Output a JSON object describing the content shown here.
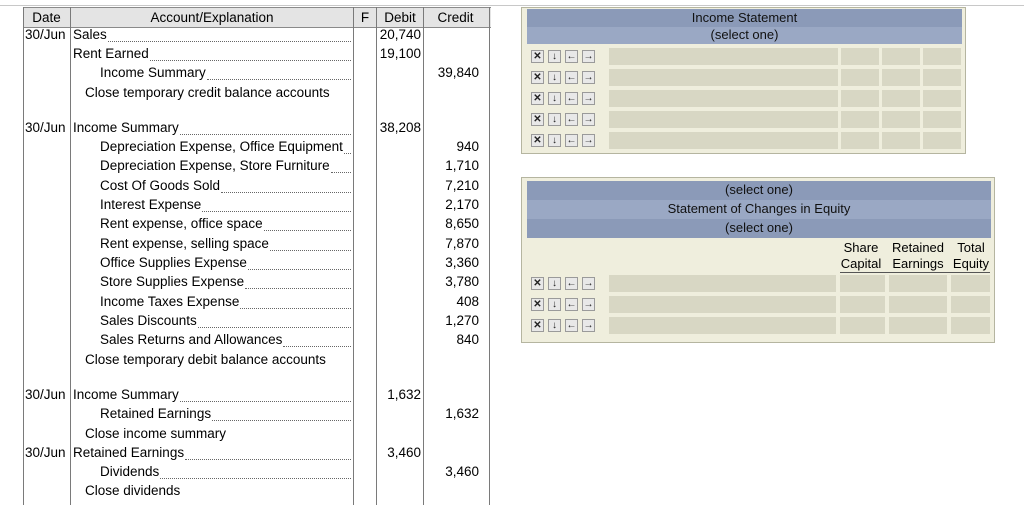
{
  "journal": {
    "headers": {
      "date": "Date",
      "account": "Account/Explanation",
      "f": "F",
      "debit": "Debit",
      "credit": "Credit"
    },
    "rows": [
      {
        "date": "30/Jun",
        "account": "Sales",
        "indent": 0,
        "debit": "20,740",
        "credit": "",
        "dots": true
      },
      {
        "date": "",
        "account": "Rent Earned",
        "indent": 0,
        "debit": "19,100",
        "credit": "",
        "dots": true
      },
      {
        "date": "",
        "account": "Income Summary",
        "indent": 2,
        "debit": "",
        "credit": "39,840",
        "dots": true
      },
      {
        "date": "",
        "account": "Close temporary credit balance accounts",
        "indent": 1,
        "debit": "",
        "credit": "",
        "dots": false
      },
      {
        "date": "30/Jun",
        "account": "Income Summary",
        "indent": 0,
        "debit": "38,208",
        "credit": "",
        "dots": true
      },
      {
        "date": "",
        "account": "Depreciation Expense, Office Equipment",
        "indent": 2,
        "debit": "",
        "credit": "940",
        "dots": true
      },
      {
        "date": "",
        "account": "Depreciation Expense, Store Furniture",
        "indent": 2,
        "debit": "",
        "credit": "1,710",
        "dots": true
      },
      {
        "date": "",
        "account": "Cost Of Goods Sold",
        "indent": 2,
        "debit": "",
        "credit": "7,210",
        "dots": true
      },
      {
        "date": "",
        "account": "Interest Expense",
        "indent": 2,
        "debit": "",
        "credit": "2,170",
        "dots": true
      },
      {
        "date": "",
        "account": "Rent expense, office space",
        "indent": 2,
        "debit": "",
        "credit": "8,650",
        "dots": true
      },
      {
        "date": "",
        "account": "Rent expense, selling space",
        "indent": 2,
        "debit": "",
        "credit": "7,870",
        "dots": true
      },
      {
        "date": "",
        "account": "Office Supplies Expense",
        "indent": 2,
        "debit": "",
        "credit": "3,360",
        "dots": true
      },
      {
        "date": "",
        "account": "Store Supplies Expense",
        "indent": 2,
        "debit": "",
        "credit": "3,780",
        "dots": true
      },
      {
        "date": "",
        "account": "Income Taxes Expense",
        "indent": 2,
        "debit": "",
        "credit": "408",
        "dots": true
      },
      {
        "date": "",
        "account": "Sales Discounts",
        "indent": 2,
        "debit": "",
        "credit": "1,270",
        "dots": true
      },
      {
        "date": "",
        "account": "Sales Returns and Allowances",
        "indent": 2,
        "debit": "",
        "credit": "840",
        "dots": true
      },
      {
        "date": "",
        "account": "Close temporary debit balance accounts",
        "indent": 1,
        "debit": "",
        "credit": "",
        "dots": false
      },
      {
        "date": "30/Jun",
        "account": "Income Summary",
        "indent": 0,
        "debit": "1,632",
        "credit": "",
        "dots": true
      },
      {
        "date": "",
        "account": "Retained Earnings",
        "indent": 2,
        "debit": "",
        "credit": "1,632",
        "dots": true
      },
      {
        "date": "",
        "account": "Close income summary",
        "indent": 1,
        "debit": "",
        "credit": "",
        "dots": false
      },
      {
        "date": "30/Jun",
        "account": "Retained Earnings",
        "indent": 0,
        "debit": "3,460",
        "credit": "",
        "dots": true
      },
      {
        "date": "",
        "account": "Dividends",
        "indent": 2,
        "debit": "",
        "credit": "3,460",
        "dots": true
      },
      {
        "date": "",
        "account": "Close dividends",
        "indent": 1,
        "debit": "",
        "credit": "",
        "dots": false
      }
    ]
  },
  "income_statement": {
    "title": "Income Statement",
    "select_label": "(select one)",
    "row_count": 5
  },
  "sce": {
    "select_top": "(select one)",
    "title": "Statement of Changes in Equity",
    "select_bottom": "(select one)",
    "col_share": "Share Capital",
    "col_retained": "Retained Earnings",
    "col_total": "Total Equity",
    "row_count": 3
  },
  "controls": {
    "delete": "✕",
    "down": "↓",
    "left": "←",
    "right": "→"
  },
  "colors": {
    "band": "#8b9ab8",
    "panel": "#efeedd",
    "cell": "#d8d7c4"
  }
}
